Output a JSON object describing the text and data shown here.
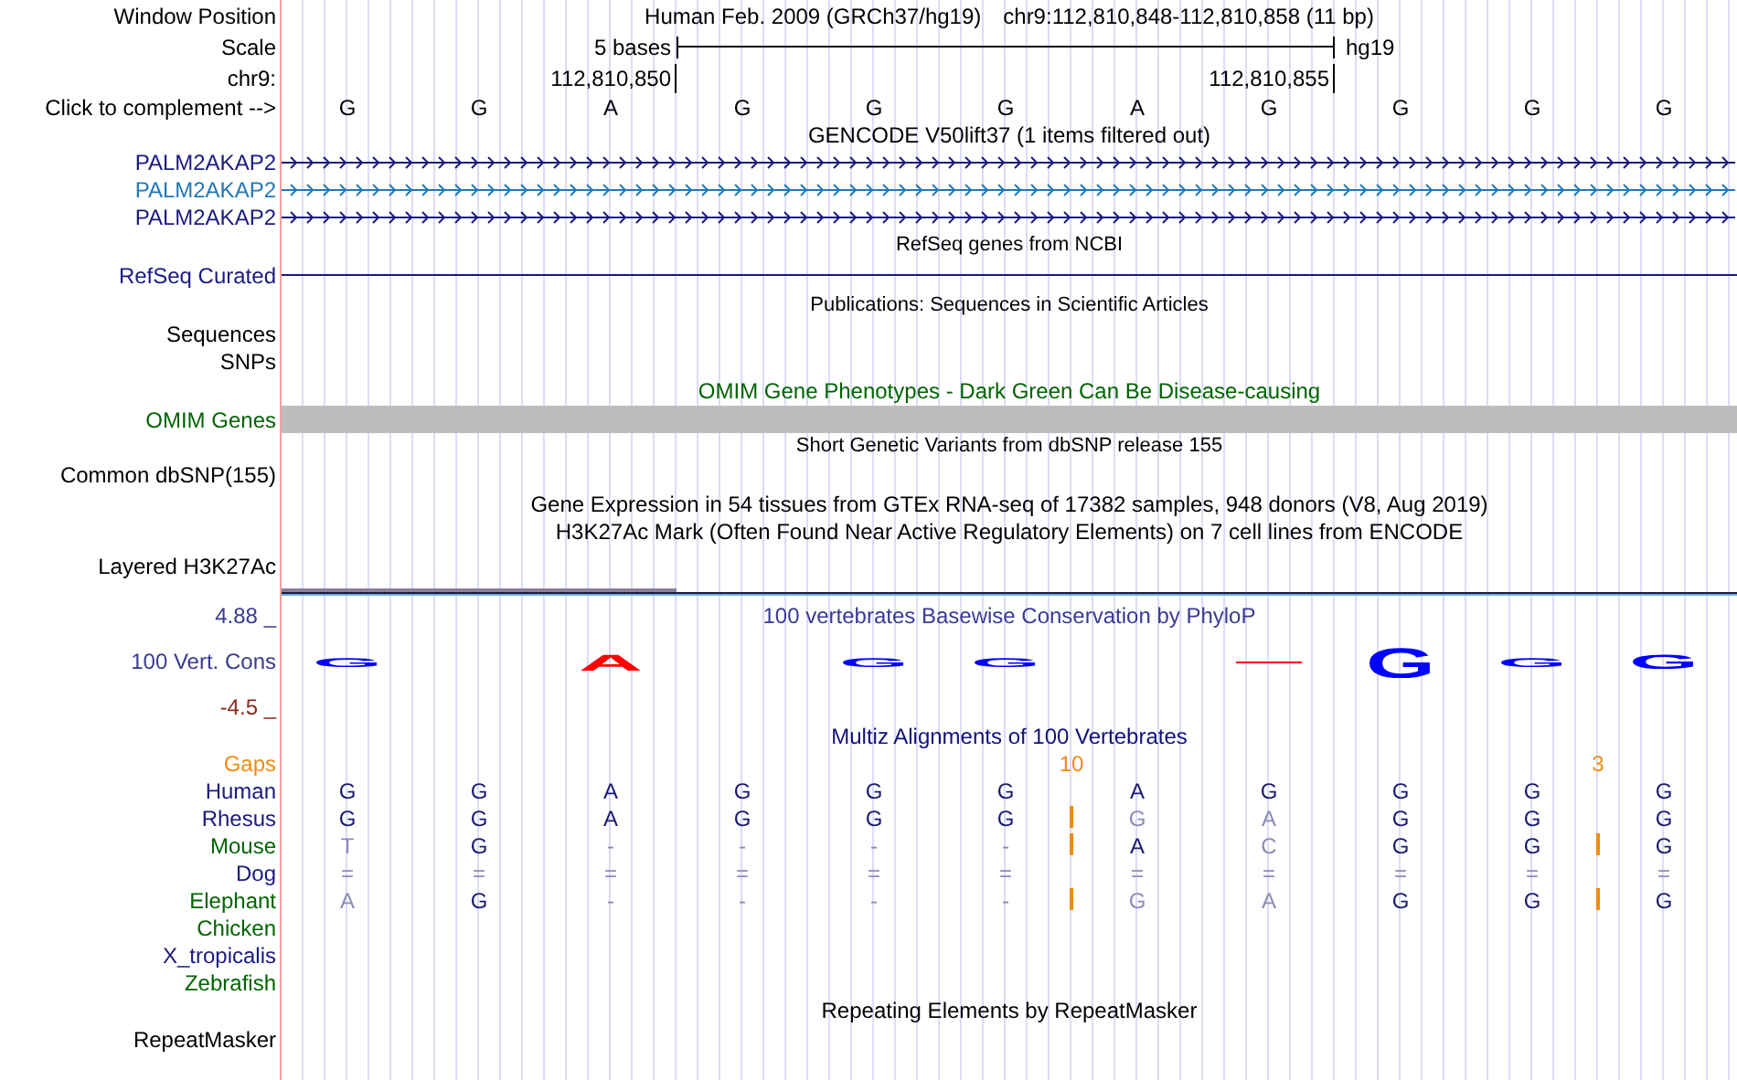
{
  "header": {
    "label": "Window Position",
    "assembly": "Human Feb. 2009 (GRCh37/hg19)",
    "position": "chr9:112,810,848-112,810,858 (11 bp)"
  },
  "scale": {
    "label": "Scale",
    "span": "5 bases",
    "db": "hg19"
  },
  "coordinates": {
    "label": "chr9:",
    "start": "112,810,850",
    "end": "112,810,855"
  },
  "sequence": {
    "label": "Click to complement -->",
    "bases": [
      "G",
      "G",
      "A",
      "G",
      "G",
      "G",
      "A",
      "G",
      "G",
      "G",
      "G"
    ]
  },
  "gencode": {
    "title": "GENCODE V50lift37 (1 items filtered out)",
    "genes": [
      {
        "name": "PALM2AKAP2",
        "color": "#1a1a80"
      },
      {
        "name": "PALM2AKAP2",
        "color": "#2178b8"
      },
      {
        "name": "PALM2AKAP2",
        "color": "#1a1a80"
      }
    ]
  },
  "refseq": {
    "title": "RefSeq genes from NCBI",
    "label": "RefSeq Curated"
  },
  "publications": {
    "title": "Publications: Sequences in Scientific Articles",
    "labels": [
      "Sequences",
      "SNPs"
    ]
  },
  "omim": {
    "title": "OMIM Gene Phenotypes - Dark Green Can Be Disease-causing",
    "label": "OMIM Genes"
  },
  "dbsnp": {
    "title": "Short Genetic Variants from dbSNP release 155",
    "label": "Common dbSNP(155)"
  },
  "gtex": {
    "title": "Gene Expression in 54 tissues from GTEx RNA-seq of 17382 samples, 948 donors (V8, Aug 2019)"
  },
  "h3k27ac": {
    "title": "H3K27Ac Mark (Often Found Near Active Regulatory Elements) on 7 cell lines from ENCODE",
    "label": "Layered H3K27Ac"
  },
  "phylop": {
    "title": "100 vertebrates Basewise Conservation by PhyloP",
    "label": "100 Vert. Cons",
    "max": "4.88 _",
    "min": "-4.5 _",
    "logo": [
      {
        "kind": "flat",
        "letter": "G",
        "color": "#0000ff"
      },
      {
        "kind": "blank"
      },
      {
        "kind": "short",
        "letter": "A",
        "color": "#ff0000"
      },
      {
        "kind": "blank"
      },
      {
        "kind": "flat",
        "letter": "G",
        "color": "#0000ff"
      },
      {
        "kind": "flat",
        "letter": "G",
        "color": "#0000ff"
      },
      {
        "kind": "blank"
      },
      {
        "kind": "dash",
        "color": "#ff0000"
      },
      {
        "kind": "tall",
        "letter": "G",
        "color": "#0000ff"
      },
      {
        "kind": "flat",
        "letter": "G",
        "color": "#0000ff"
      },
      {
        "kind": "mid",
        "letter": "G",
        "color": "#0000ff"
      }
    ]
  },
  "multiz": {
    "title": "Multiz Alignments of 100 Vertebrates",
    "gaps_label": "Gaps",
    "gaps": [
      {
        "kind": "blank"
      },
      {
        "kind": "blank"
      },
      {
        "kind": "blank"
      },
      {
        "kind": "blank"
      },
      {
        "kind": "blank"
      },
      {
        "kind": "count",
        "text": "10"
      },
      {
        "kind": "blank"
      },
      {
        "kind": "blank"
      },
      {
        "kind": "blank"
      },
      {
        "kind": "count",
        "text": "3"
      },
      {
        "kind": "blank"
      }
    ],
    "species": [
      {
        "name": "Human",
        "color": "#1a1a80",
        "cells": [
          {
            "base": "G",
            "faded": false,
            "insertion_after": false
          },
          {
            "base": "G",
            "faded": false,
            "insertion_after": false
          },
          {
            "base": "A",
            "faded": false,
            "insertion_after": false
          },
          {
            "base": "G",
            "faded": false,
            "insertion_after": false
          },
          {
            "base": "G",
            "faded": false,
            "insertion_after": false
          },
          {
            "base": "G",
            "faded": false,
            "insertion_after": false
          },
          {
            "base": "A",
            "faded": false,
            "insertion_after": false
          },
          {
            "base": "G",
            "faded": false,
            "insertion_after": false
          },
          {
            "base": "G",
            "faded": false,
            "insertion_after": false
          },
          {
            "base": "G",
            "faded": false,
            "insertion_after": false
          },
          {
            "base": "G",
            "faded": false,
            "insertion_after": false
          }
        ]
      },
      {
        "name": "Rhesus",
        "color": "#1a1a80",
        "cells": [
          {
            "base": "G",
            "faded": false,
            "insertion_after": false
          },
          {
            "base": "G",
            "faded": false,
            "insertion_after": false
          },
          {
            "base": "A",
            "faded": false,
            "insertion_after": false
          },
          {
            "base": "G",
            "faded": false,
            "insertion_after": false
          },
          {
            "base": "G",
            "faded": false,
            "insertion_after": false
          },
          {
            "base": "G",
            "faded": false,
            "insertion_after": true
          },
          {
            "base": "G",
            "faded": true,
            "insertion_after": false
          },
          {
            "base": "A",
            "faded": true,
            "insertion_after": false
          },
          {
            "base": "G",
            "faded": false,
            "insertion_after": false
          },
          {
            "base": "G",
            "faded": false,
            "insertion_after": false
          },
          {
            "base": "G",
            "faded": false,
            "insertion_after": false
          }
        ]
      },
      {
        "name": "Mouse",
        "color": "#006400",
        "cells": [
          {
            "base": "T",
            "faded": true,
            "insertion_after": false
          },
          {
            "base": "G",
            "faded": false,
            "insertion_after": false
          },
          {
            "base": "-",
            "faded": true,
            "insertion_after": false
          },
          {
            "base": "-",
            "faded": true,
            "insertion_after": false
          },
          {
            "base": "-",
            "faded": true,
            "insertion_after": false
          },
          {
            "base": "-",
            "faded": true,
            "insertion_after": true
          },
          {
            "base": "A",
            "faded": false,
            "insertion_after": false
          },
          {
            "base": "C",
            "faded": true,
            "insertion_after": false
          },
          {
            "base": "G",
            "faded": false,
            "insertion_after": false
          },
          {
            "base": "G",
            "faded": false,
            "insertion_after": true
          },
          {
            "base": "G",
            "faded": false,
            "insertion_after": false
          }
        ]
      },
      {
        "name": "Dog",
        "color": "#1a1a80",
        "cells": [
          {
            "base": "=",
            "faded": true,
            "insertion_after": false
          },
          {
            "base": "=",
            "faded": true,
            "insertion_after": false
          },
          {
            "base": "=",
            "faded": true,
            "insertion_after": false
          },
          {
            "base": "=",
            "faded": true,
            "insertion_after": false
          },
          {
            "base": "=",
            "faded": true,
            "insertion_after": false
          },
          {
            "base": "=",
            "faded": true,
            "insertion_after": false
          },
          {
            "base": "=",
            "faded": true,
            "insertion_after": false
          },
          {
            "base": "=",
            "faded": true,
            "insertion_after": false
          },
          {
            "base": "=",
            "faded": true,
            "insertion_after": false
          },
          {
            "base": "=",
            "faded": true,
            "insertion_after": false
          },
          {
            "base": "=",
            "faded": true,
            "insertion_after": false
          }
        ]
      },
      {
        "name": "Elephant",
        "color": "#006400",
        "cells": [
          {
            "base": "A",
            "faded": true,
            "insertion_after": false
          },
          {
            "base": "G",
            "faded": false,
            "insertion_after": false
          },
          {
            "base": "-",
            "faded": true,
            "insertion_after": false
          },
          {
            "base": "-",
            "faded": true,
            "insertion_after": false
          },
          {
            "base": "-",
            "faded": true,
            "insertion_after": false
          },
          {
            "base": "-",
            "faded": true,
            "insertion_after": true
          },
          {
            "base": "G",
            "faded": true,
            "insertion_after": false
          },
          {
            "base": "A",
            "faded": true,
            "insertion_after": false
          },
          {
            "base": "G",
            "faded": false,
            "insertion_after": false
          },
          {
            "base": "G",
            "faded": false,
            "insertion_after": true
          },
          {
            "base": "G",
            "faded": false,
            "insertion_after": false
          }
        ]
      },
      {
        "name": "Chicken",
        "color": "#006400"
      },
      {
        "name": "X_tropicalis",
        "color": "#1a1a80"
      },
      {
        "name": "Zebrafish",
        "color": "#006400"
      }
    ]
  },
  "repeatmasker": {
    "title": "Repeating Elements by RepeatMasker",
    "label": "RepeatMasker"
  }
}
